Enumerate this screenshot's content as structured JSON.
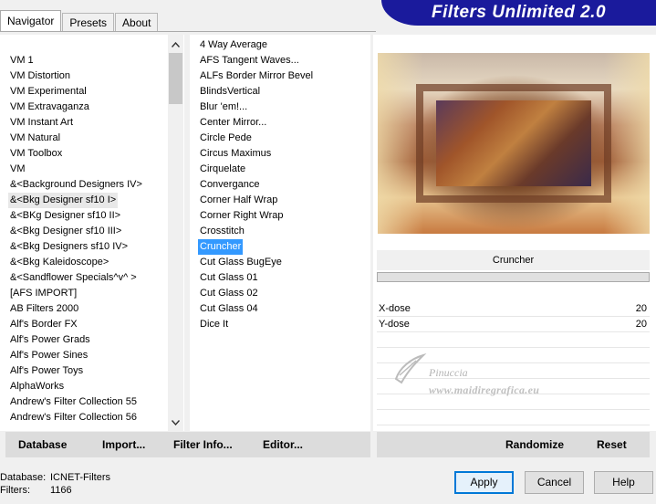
{
  "tabs": [
    "Navigator",
    "Presets",
    "About"
  ],
  "banner": "Filters Unlimited 2.0",
  "categories": [
    "VM 1",
    "VM Distortion",
    "VM Experimental",
    "VM Extravaganza",
    "VM Instant Art",
    "VM Natural",
    "VM Toolbox",
    "VM",
    "&<Background Designers IV>",
    "&<Bkg Designer sf10 I>",
    "&<BKg Designer sf10 II>",
    "&<Bkg Designer sf10 III>",
    "&<Bkg Designers sf10 IV>",
    "&<Bkg Kaleidoscope>",
    "&<Sandflower Specials^v^ >",
    "[AFS IMPORT]",
    "AB Filters 2000",
    "Alf's Border FX",
    "Alf's Power Grads",
    "Alf's Power Sines",
    "Alf's Power Toys",
    "AlphaWorks",
    "Andrew's Filter Collection 55",
    "Andrew's Filter Collection 56"
  ],
  "selected_category_index": 9,
  "filters": [
    "4 Way Average",
    "AFS Tangent Waves...",
    "ALFs Border Mirror Bevel",
    "BlindsVertical",
    "Blur 'em!...",
    "Center Mirror...",
    "Circle Pede",
    "Circus Maximus",
    "Cirquelate",
    "Convergance",
    "Corner Half Wrap",
    "Corner Right Wrap",
    "Crosstitch",
    "Cruncher",
    "Cut Glass  BugEye",
    "Cut Glass 01",
    "Cut Glass 02",
    "Cut Glass 04",
    "Dice It"
  ],
  "selected_filter_index": 13,
  "current_filter": "Cruncher",
  "params": [
    {
      "label": "X-dose",
      "value": "20"
    },
    {
      "label": "Y-dose",
      "value": "20"
    }
  ],
  "watermark": {
    "name": "Pinuccia",
    "url": "www.maidiregrafica.eu"
  },
  "left_buttons": [
    "Database",
    "Import...",
    "Filter Info...",
    "Editor..."
  ],
  "right_buttons": [
    "Randomize",
    "Reset"
  ],
  "status": {
    "database_label": "Database:",
    "database_value": "ICNET-Filters",
    "filters_label": "Filters:",
    "filters_value": "1166"
  },
  "dialog_buttons": {
    "apply": "Apply",
    "cancel": "Cancel",
    "help": "Help"
  },
  "scroll": {
    "up": "^",
    "down": "v"
  }
}
